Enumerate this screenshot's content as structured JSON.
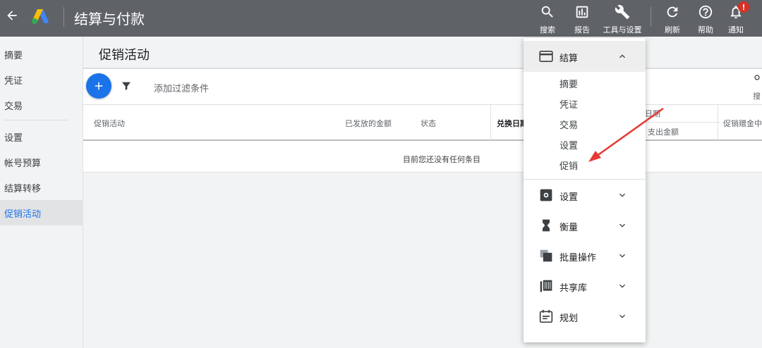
{
  "topbar": {
    "title": "结算与付款",
    "actions": [
      {
        "label": "搜索",
        "icon": "search-icon"
      },
      {
        "label": "报告",
        "icon": "report-icon"
      },
      {
        "label": "工具与设置",
        "icon": "wrench-icon"
      },
      {
        "label": "刷新",
        "icon": "refresh-icon"
      },
      {
        "label": "帮助",
        "icon": "help-icon"
      },
      {
        "label": "通知",
        "icon": "bell-icon"
      }
    ],
    "notification_badge": "!"
  },
  "leftnav": {
    "items": [
      {
        "label": "摘要"
      },
      {
        "label": "凭证"
      },
      {
        "label": "交易"
      },
      {
        "label": "设置"
      },
      {
        "label": "帐号预算"
      },
      {
        "label": "结算转移"
      },
      {
        "label": "促销活动",
        "active": true
      }
    ]
  },
  "main": {
    "page_title": "促销活动",
    "filter_placeholder": "添加过滤条件",
    "search_label": "搜",
    "columns": [
      "促销活动",
      "已发放的金额",
      "状态",
      "兑换日期",
      "日期",
      "支出金额",
      "促销赠金中"
    ],
    "empty_message": "目前您还没有任何条目"
  },
  "dropdown": {
    "section_label": "结算",
    "section_items": [
      "摘要",
      "凭证",
      "交易",
      "设置",
      "促销"
    ],
    "items": [
      {
        "label": "设置",
        "icon": "gear-icon"
      },
      {
        "label": "衡量",
        "icon": "hourglass-icon"
      },
      {
        "label": "批量操作",
        "icon": "bulk-actions-icon"
      },
      {
        "label": "共享库",
        "icon": "library-icon"
      },
      {
        "label": "规划",
        "icon": "planning-icon"
      }
    ]
  },
  "colors": {
    "topbar": "#5f6368",
    "accent": "#1a73e8",
    "annotation": "#e53935",
    "badge": "#d93025"
  }
}
